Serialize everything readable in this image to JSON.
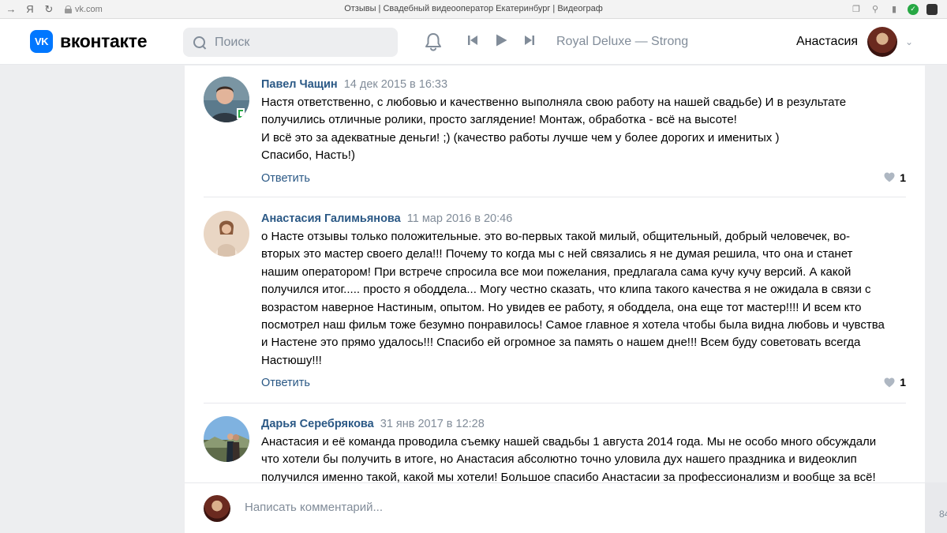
{
  "browser": {
    "back_icon": "arrow-left-icon",
    "yandex_label": "Я",
    "url": "vk.com",
    "title": "Отзывы | Свадебный видеооператор Екатеринбург | Видеограф"
  },
  "header": {
    "logo_mark": "VK",
    "logo_text": "вконтакте",
    "search_placeholder": "Поиск",
    "track": "Royal Deluxe — Strong",
    "user_name": "Анастасия",
    "brand_color": "#0077ff",
    "link_color": "#2a5885"
  },
  "comments": [
    {
      "author": "Павел Чащин",
      "date": "14 дек 2015 в 16:33",
      "lines": [
        "Настя ответственно, с любовью и качественно выполняла свою работу на нашей свадьбе) И в результате",
        "получились отличные ролики, просто заглядение! Монтаж, обработка - всё на высоте!",
        "И всё это за адекватные деньги! ;) (качество работы лучше чем у более дорогих и именитых )",
        "Спасибо, Насть!)"
      ],
      "reply_label": "Ответить",
      "likes": "1"
    },
    {
      "author": "Анастасия Галимьянова",
      "date": "11 мар 2016 в 20:46",
      "lines": [
        "о Насте отзывы только положительные. это во-первых такой милый, общительный, добрый человечек, во-",
        "вторых это мастер своего дела!!! Почему то когда мы с ней связались я не думая решила, что она и станет",
        "нашим оператором! При встрече спросила все мои пожелания, предлагала сама кучу кучу версий. А какой",
        "получился итог..... просто я ободдела... Могу честно сказать, что клипа такого качества я не ожидала в связи с",
        "возрастом наверное Настиным, опытом. Но увидев ее работу, я ободдела, она еще тот мастер!!!! И всем кто",
        "посмотрел наш фильм тоже безумно понравилось! Самое главное я хотела чтобы была видна любовь и чувства",
        "и Настене это прямо удалось!!! Спасибо ей огромное за память о нашем дне!!! Всем буду советовать всегда",
        "Настюшу!!!"
      ],
      "reply_label": "Ответить",
      "likes": "1"
    },
    {
      "author": "Дарья Серебрякова",
      "date": "31 янв 2017 в 12:28",
      "lines": [
        "Анастасия и её команда проводила съемку нашей свадьбы 1 августа 2014 года. Мы не особо много обсуждали",
        "что хотели бы получить в итоге, но Анастасия абсолютно точно уловила дух нашего праздника и видеоклип",
        "получился именно такой, какой мы хотели! Большое спасибо Анастасии за профессионализм и вообще за всё!"
      ]
    }
  ],
  "compose": {
    "placeholder": "Написать комментарий..."
  },
  "side": {
    "number": "84"
  }
}
